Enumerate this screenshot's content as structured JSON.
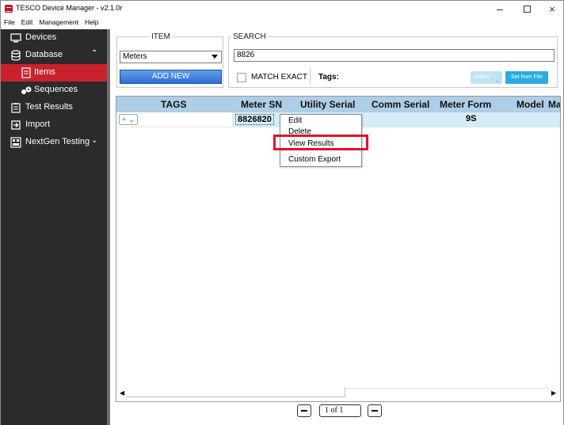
{
  "window": {
    "title": "TESCO Device Manager - v2.1.0r",
    "controls": {
      "minimize": "–",
      "maximize": "□",
      "close": "×"
    }
  },
  "menu": [
    "File",
    "Edit",
    "Management",
    "Help"
  ],
  "sidebar": {
    "items": [
      {
        "label": "Devices",
        "icon": "monitor-icon"
      },
      {
        "label": "Database",
        "icon": "database-icon",
        "expanded": true
      },
      {
        "label": "Items",
        "icon": "items-icon",
        "active": true
      },
      {
        "label": "Sequences",
        "icon": "sequences-icon"
      },
      {
        "label": "Test Results",
        "icon": "clipboard-icon"
      },
      {
        "label": "Import",
        "icon": "import-icon"
      },
      {
        "label": "NextGen Testing",
        "icon": "nextgen-icon"
      }
    ],
    "colors": {
      "background": "#2b2b2b",
      "active": "#c8232c"
    }
  },
  "item_panel": {
    "legend": "ITEM",
    "selected": "Meters",
    "add_new_label": "ADD NEW"
  },
  "search_panel": {
    "legend": "SEARCH",
    "value": "8826",
    "match_exact_label": "MATCH EXACT",
    "match_exact_checked": false,
    "tags_label": "Tags:",
    "select_label": "Select",
    "set_from_file_label": "Set from File"
  },
  "table": {
    "columns": [
      "TAGS",
      "Meter SN",
      "Utility Serial",
      "Comm Serial",
      "Meter Form",
      "Model",
      "Ma"
    ],
    "rows": [
      {
        "tags_button": "+",
        "meter_sn": "8826820",
        "utility_serial": "",
        "comm_serial": "",
        "meter_form": "9S",
        "model": ""
      }
    ],
    "header_color": "#aecde6"
  },
  "context_menu": {
    "items": [
      "Edit",
      "Delete",
      "View Results",
      "Custom Export"
    ],
    "highlighted": "View Results",
    "highlight_color": "#e1122a"
  },
  "pager": {
    "text": "1  of 1"
  }
}
